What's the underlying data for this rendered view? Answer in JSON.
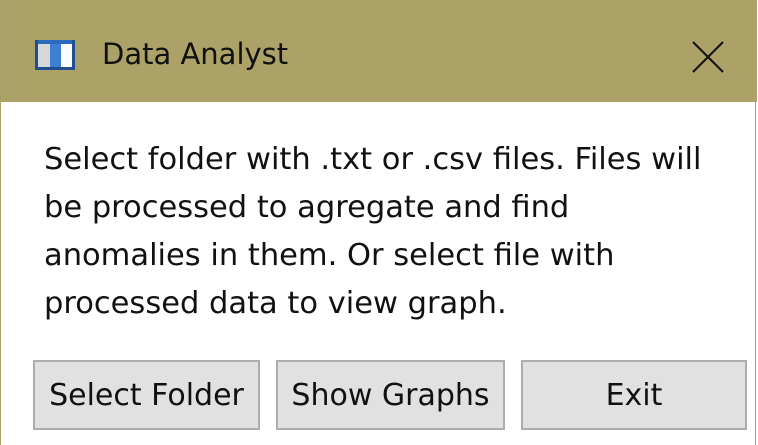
{
  "window": {
    "title": "Data Analyst",
    "icon": "application-window-icon",
    "close_icon": "close-icon",
    "titlebar_color": "#aca166"
  },
  "description": {
    "lines": [
      "Select folder with .txt or .csv files. Files will",
      "be processed to agregate and find",
      "anomalies in them. Or select file with",
      "processed data to view graph."
    ]
  },
  "buttons": {
    "select_folder": "Select Folder",
    "show_graphs": "Show Graphs",
    "exit": "Exit"
  }
}
